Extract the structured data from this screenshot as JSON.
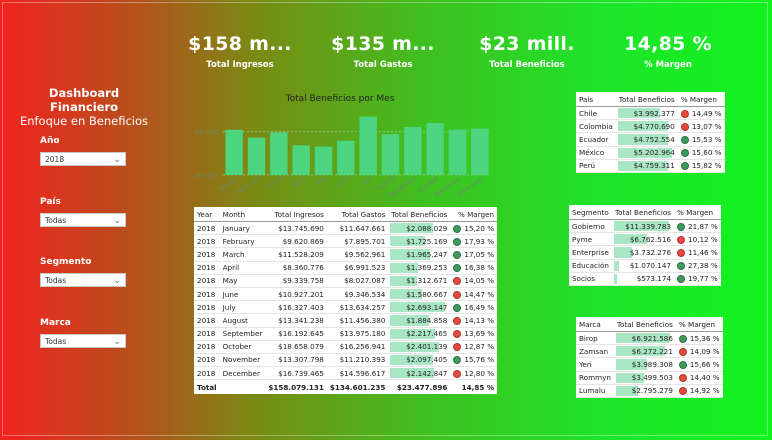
{
  "kpis": [
    {
      "value": "$158 m...",
      "label": "Total Ingresos"
    },
    {
      "value": "$135 m...",
      "label": "Total Gastos"
    },
    {
      "value": "$23 mill.",
      "label": "Total Beneficios"
    },
    {
      "value": "14,85 %",
      "label": "% Margen"
    }
  ],
  "dashboard": {
    "title": "Dashboard Financiero",
    "subtitle": "Enfoque en Beneficios"
  },
  "slicers": [
    {
      "label": "Año",
      "value": "2018"
    },
    {
      "label": "País",
      "value": "Todas"
    },
    {
      "label": "Segmento",
      "value": "Todas"
    },
    {
      "label": "Marca",
      "value": "Todas"
    }
  ],
  "chart_data": {
    "type": "bar",
    "title": "Total Beneficios por Mes",
    "categories": [
      "January",
      "February",
      "March",
      "April",
      "May",
      "June",
      "July",
      "August",
      "September",
      "October",
      "November",
      "December"
    ],
    "values": [
      2.088,
      1.725,
      1.965,
      1.369,
      1.312,
      1.581,
      2.694,
      1.885,
      2.217,
      2.401,
      2.097,
      2.143
    ],
    "ylabel": "",
    "y_ticks": [
      "$2 mill.",
      "$0 mill."
    ],
    "ylim": [
      0,
      3.0
    ],
    "color": "#4cd47e"
  },
  "monthly_table": {
    "headers": [
      "Year",
      "Month",
      "Total Ingresos",
      "Total Gastos",
      "Total Beneficios",
      "% Margen"
    ],
    "rows": [
      [
        "2018",
        "January",
        "$13.745.690",
        "$11.647.661",
        "$2.088.029",
        "15,20 %",
        "g",
        0.775
      ],
      [
        "2018",
        "February",
        "$9.620.869",
        "$7.895.701",
        "$1.725.169",
        "17,93 %",
        "g",
        0.64
      ],
      [
        "2018",
        "March",
        "$11.528.209",
        "$9.562.961",
        "$1.965.247",
        "17,05 %",
        "g",
        0.73
      ],
      [
        "2018",
        "April",
        "$8.360.776",
        "$6.991.523",
        "$1.369.253",
        "16,38 %",
        "g",
        0.508
      ],
      [
        "2018",
        "May",
        "$9.339.758",
        "$8.027.087",
        "$1.312.671",
        "14,05 %",
        "r",
        0.487
      ],
      [
        "2018",
        "June",
        "$10.927.201",
        "$9.346.534",
        "$1.580.667",
        "14,47 %",
        "r",
        0.587
      ],
      [
        "2018",
        "July",
        "$16.327.403",
        "$13.634.257",
        "$2.693.147",
        "16,49 %",
        "g",
        1.0
      ],
      [
        "2018",
        "August",
        "$13.341.238",
        "$11.456.380",
        "$1.884.858",
        "14,13 %",
        "r",
        0.7
      ],
      [
        "2018",
        "September",
        "$16.192.645",
        "$13.975.180",
        "$2.217.465",
        "13,69 %",
        "r",
        0.823
      ],
      [
        "2018",
        "October",
        "$18.658.079",
        "$16.256.941",
        "$2.401.139",
        "12,87 %",
        "r",
        0.892
      ],
      [
        "2018",
        "November",
        "$13.307.798",
        "$11.210.393",
        "$2.097.405",
        "15,76 %",
        "g",
        0.779
      ],
      [
        "2018",
        "December",
        "$16.739.465",
        "$14.596.617",
        "$2.142.847",
        "12,80 %",
        "r",
        0.796
      ]
    ],
    "total": [
      "Total",
      "",
      "$158.079.131",
      "$134.601.235",
      "$23.477.896",
      "14,85 %"
    ]
  },
  "country_table": {
    "headers": [
      "País",
      "Total Beneficios",
      "% Margen"
    ],
    "rows": [
      [
        "Chile",
        "$3.992.377",
        "14,49 %",
        "r",
        0.767
      ],
      [
        "Colombia",
        "$4.770.690",
        "13,07 %",
        "r",
        0.917
      ],
      [
        "Ecuador",
        "$4.752.554",
        "15,53 %",
        "g",
        0.914
      ],
      [
        "México",
        "$5.202.964",
        "15,60 %",
        "g",
        1.0
      ],
      [
        "Perú",
        "$4.759.311",
        "15,82 %",
        "g",
        0.915
      ]
    ]
  },
  "segment_table": {
    "headers": [
      "Segmento",
      "Total Beneficios",
      "% Margen"
    ],
    "rows": [
      [
        "Gobierno",
        "$11.339.783",
        "21,87 %",
        "g",
        1.0
      ],
      [
        "Pyme",
        "$6.762.516",
        "10,12 %",
        "r",
        0.596
      ],
      [
        "Enterprise",
        "$3.732.276",
        "11,46 %",
        "r",
        0.329
      ],
      [
        "Educación",
        "$1.070.147",
        "27,38 %",
        "g",
        0.094
      ],
      [
        "Socios",
        "$573.174",
        "19,77 %",
        "g",
        0.051
      ]
    ]
  },
  "brand_table": {
    "headers": [
      "Marca",
      "Total Beneficios",
      "% Margen"
    ],
    "rows": [
      [
        "Birop",
        "$6.921.586",
        "15,36 %",
        "g",
        1.0
      ],
      [
        "Zamsan",
        "$6.272.221",
        "14,09 %",
        "r",
        0.906
      ],
      [
        "Yeri",
        "$3.989.308",
        "15,66 %",
        "g",
        0.576
      ],
      [
        "Rommyn",
        "$3.499.503",
        "14,40 %",
        "r",
        0.506
      ],
      [
        "Lumalu",
        "$2.795.279",
        "14,92 %",
        "r",
        0.404
      ]
    ]
  }
}
